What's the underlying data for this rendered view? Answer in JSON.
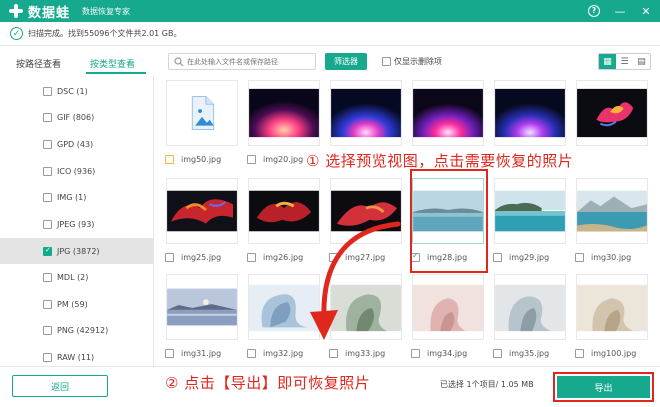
{
  "app": {
    "name": "数据蛙",
    "subtitle": "数据恢复专家"
  },
  "window_controls": {
    "help": "?",
    "minimize": "—",
    "close": "✕"
  },
  "status": {
    "text": "扫描完成。找到55096个文件共2.01 GB。"
  },
  "tabs": [
    {
      "label": "按路径查看"
    },
    {
      "label": "按类型查看",
      "active": true
    }
  ],
  "search": {
    "placeholder": "在此处输入文件名或保存路径"
  },
  "filter_button": "筛选器",
  "only_deleted": {
    "label": "仅显示删除项",
    "checked": false
  },
  "view_modes": [
    {
      "icon": "grid-view-icon",
      "active": true
    },
    {
      "icon": "list-view-icon",
      "active": false
    },
    {
      "icon": "detail-view-icon",
      "active": false
    }
  ],
  "sidebar": {
    "items": [
      {
        "label": "DSC (1)",
        "checked": false,
        "active": false
      },
      {
        "label": "GIF (806)",
        "checked": false,
        "active": false
      },
      {
        "label": "GPD (43)",
        "checked": false,
        "active": false
      },
      {
        "label": "ICO (936)",
        "checked": false,
        "active": false
      },
      {
        "label": "IMG (1)",
        "checked": false,
        "active": false
      },
      {
        "label": "JPEG (93)",
        "checked": false,
        "active": false
      },
      {
        "label": "JPG (3872)",
        "checked": true,
        "active": true
      },
      {
        "label": "MDL (2)",
        "checked": false,
        "active": false
      },
      {
        "label": "PM (59)",
        "checked": false,
        "active": false
      },
      {
        "label": "PNG (42912)",
        "checked": false,
        "active": false
      },
      {
        "label": "RAW (11)",
        "checked": false,
        "active": false
      }
    ]
  },
  "files": [
    {
      "name": "img50.jpg",
      "checked": false,
      "thumb": "file-placeholder"
    },
    {
      "name": "img20.jpg",
      "checked": false,
      "thumb": "glow-pink"
    },
    {
      "name": "",
      "checked": false,
      "thumb": "glow-blue"
    },
    {
      "name": "",
      "checked": false,
      "thumb": "glow-magenta"
    },
    {
      "name": "",
      "checked": false,
      "thumb": "glow-violet"
    },
    {
      "name": "",
      "checked": false,
      "thumb": "flower-dark"
    },
    {
      "name": "img25.jpg",
      "checked": false,
      "thumb": "abstract-red"
    },
    {
      "name": "img26.jpg",
      "checked": false,
      "thumb": "abstract-red2"
    },
    {
      "name": "img27.jpg",
      "checked": false,
      "thumb": "abstract-red3"
    },
    {
      "name": "img28.jpg",
      "checked": true,
      "thumb": "lake"
    },
    {
      "name": "img29.jpg",
      "checked": false,
      "thumb": "coast"
    },
    {
      "name": "img30.jpg",
      "checked": false,
      "thumb": "mountain-sea"
    },
    {
      "name": "img31.jpg",
      "checked": false,
      "thumb": "dusk-lake"
    },
    {
      "name": "img32.jpg",
      "checked": false,
      "thumb": "silk-blue"
    },
    {
      "name": "img33.jpg",
      "checked": false,
      "thumb": "silk-green"
    },
    {
      "name": "img34.jpg",
      "checked": false,
      "thumb": "silk-pink"
    },
    {
      "name": "img35.jpg",
      "checked": false,
      "thumb": "silk-grey"
    },
    {
      "name": "img100.jpg",
      "checked": false,
      "thumb": "silk-beige"
    }
  ],
  "annotations": {
    "step1": "① 选择预览视图，点击需要恢复的照片",
    "step2": "② 点击【导出】即可恢复照片"
  },
  "bottom": {
    "back_label": "返回",
    "selected_info": "已选择 1个项目/ 1.05 MB",
    "export_label": "导出"
  },
  "colors": {
    "accent": "#16a98e",
    "annotation": "#e0271e"
  }
}
